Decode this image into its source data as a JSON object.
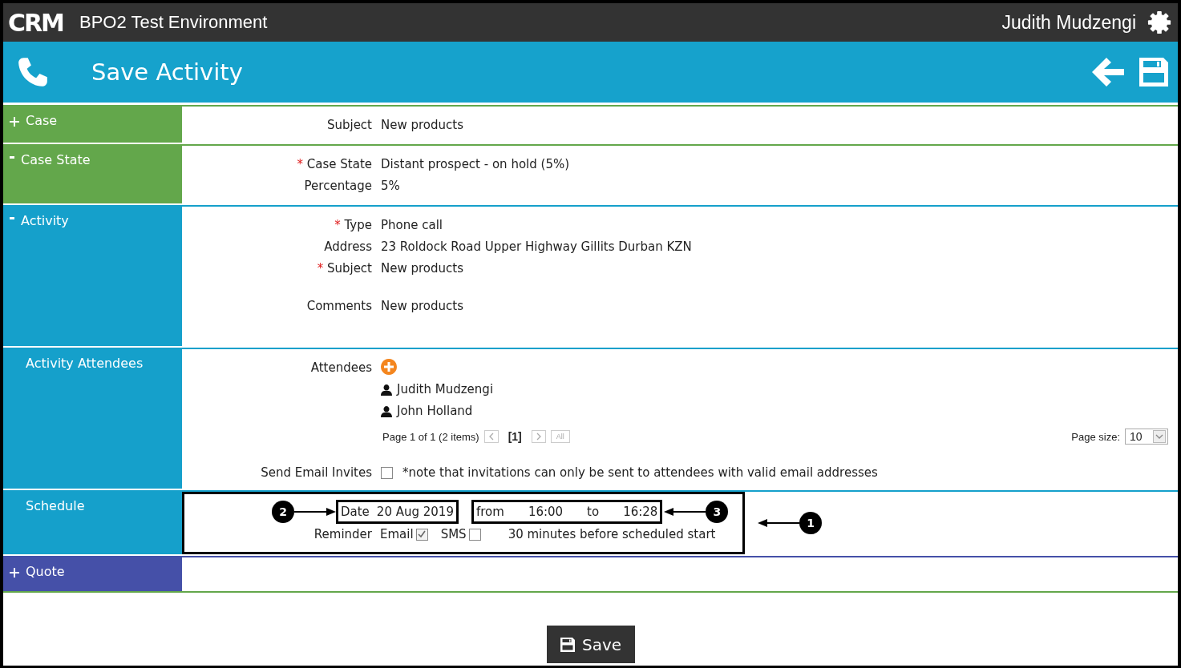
{
  "app": {
    "logo": "CRM",
    "environment": "BPO2 Test Environment",
    "user": "Judith Mudzengi"
  },
  "page": {
    "title": "Save Activity"
  },
  "sections": [
    {
      "kind": "fields",
      "title": "Case",
      "color": "#63a74b",
      "expanded": false,
      "fields": [
        {
          "kind": "text",
          "label": "Subject",
          "value": "New products"
        }
      ]
    },
    {
      "kind": "fields",
      "title": "Case State",
      "color": "#63a74b",
      "expanded": true,
      "fields": [
        {
          "kind": "text",
          "required": "*",
          "label": "Case State",
          "value": "Distant prospect - on hold (5%)"
        },
        {
          "kind": "text",
          "label": "Percentage",
          "value": "5%"
        }
      ]
    },
    {
      "kind": "fields",
      "title": "Activity",
      "color": "#15a0cb",
      "expanded": true,
      "fields": [
        {
          "kind": "text",
          "required": "*",
          "label": "Type",
          "value": "Phone call"
        },
        {
          "kind": "text",
          "label": "Address",
          "value": "23 Roldock Road Upper Highway Gillits Durban KZN"
        },
        {
          "kind": "text",
          "required": "*",
          "label": "Subject",
          "value": "New products"
        },
        {
          "kind": "memo",
          "label": "Comments",
          "value": "New products"
        }
      ]
    },
    {
      "kind": "attendees",
      "title": "Activity Attendees",
      "color": "#15a0cb",
      "label": "Attendees",
      "people": [
        "Judith Mudzengi",
        "John Holland"
      ],
      "pager": {
        "summary": "Page 1 of 1 (2 items)",
        "current": "[1]",
        "all": "All",
        "page_size_label": "Page size:",
        "page_size": "10"
      },
      "invites": {
        "label": "Send Email Invites",
        "checked": false,
        "note": "*note that invitations can only be sent to attendees with valid email addresses"
      }
    },
    {
      "kind": "schedule",
      "title": "Schedule",
      "color": "#15a0cb",
      "callout": "1",
      "date": {
        "label": "Date",
        "value": "20 Aug 2019",
        "callout": "2"
      },
      "time": {
        "callout": "3",
        "from": {
          "label": "from",
          "value": "16:00"
        },
        "to": {
          "label": "to",
          "value": "16:28"
        }
      },
      "reminder": {
        "label": "Reminder",
        "options": [
          {
            "label": "Email",
            "checked": true
          },
          {
            "label": "SMS",
            "checked": false
          }
        ],
        "text": "30 minutes before scheduled start"
      }
    },
    {
      "kind": "fields",
      "title": "Quote",
      "color": "#4550a8",
      "expanded": false
    }
  ],
  "save_button": "Save"
}
